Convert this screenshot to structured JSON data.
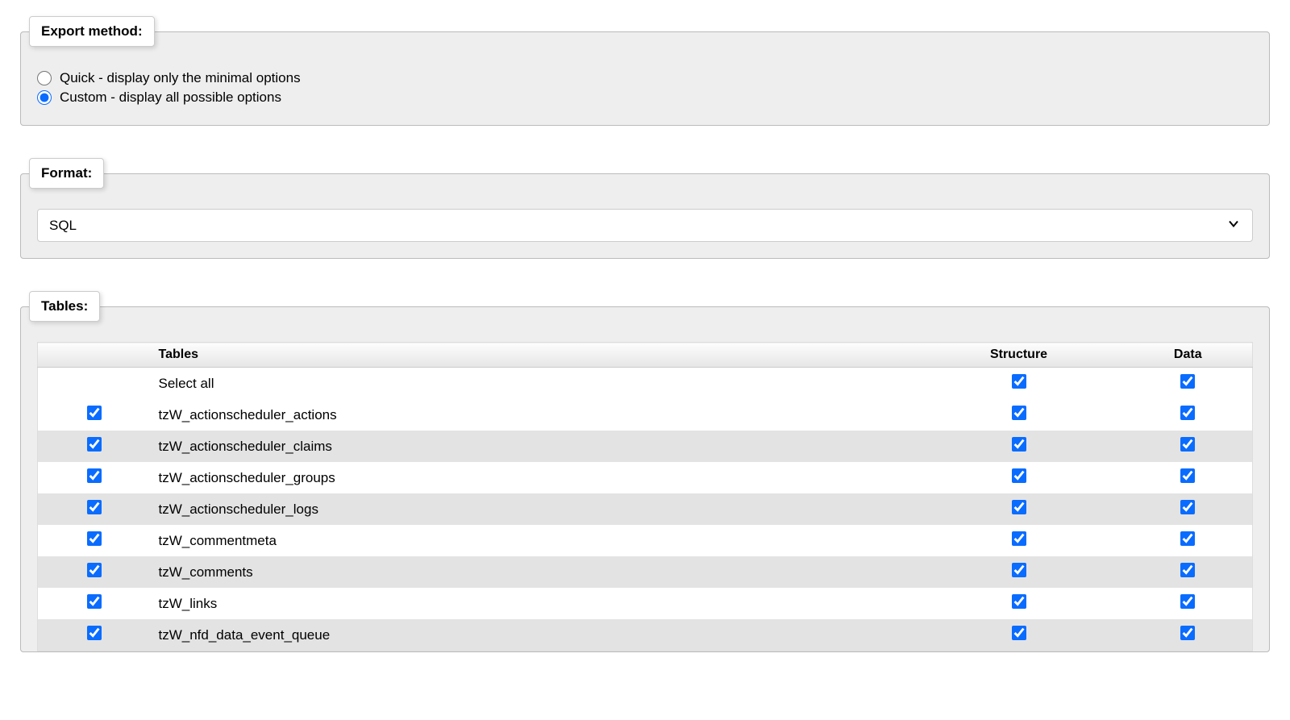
{
  "export_method": {
    "legend": "Export method:",
    "quick_label": "Quick - display only the minimal options",
    "custom_label": "Custom - display all possible options",
    "selected": "custom"
  },
  "format": {
    "legend": "Format:",
    "selected": "SQL"
  },
  "tables": {
    "legend": "Tables:",
    "headers": {
      "name": "Tables",
      "structure": "Structure",
      "data": "Data"
    },
    "select_all_label": "Select all",
    "select_all_structure": true,
    "select_all_data": true,
    "rows": [
      {
        "name": "tzW_actionscheduler_actions",
        "selected": true,
        "structure": true,
        "data": true
      },
      {
        "name": "tzW_actionscheduler_claims",
        "selected": true,
        "structure": true,
        "data": true
      },
      {
        "name": "tzW_actionscheduler_groups",
        "selected": true,
        "structure": true,
        "data": true
      },
      {
        "name": "tzW_actionscheduler_logs",
        "selected": true,
        "structure": true,
        "data": true
      },
      {
        "name": "tzW_commentmeta",
        "selected": true,
        "structure": true,
        "data": true
      },
      {
        "name": "tzW_comments",
        "selected": true,
        "structure": true,
        "data": true
      },
      {
        "name": "tzW_links",
        "selected": true,
        "structure": true,
        "data": true
      },
      {
        "name": "tzW_nfd_data_event_queue",
        "selected": true,
        "structure": true,
        "data": true
      }
    ]
  }
}
